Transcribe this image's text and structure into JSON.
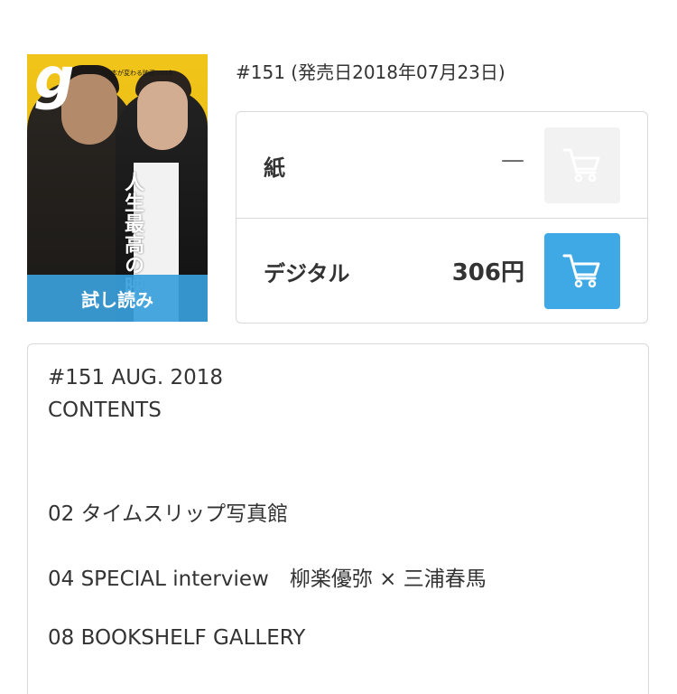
{
  "cover": {
    "alt": "magazine cover",
    "preview_label": "試し読み",
    "cover_title_vertical": "人生最高の映",
    "cover_tagline": "日本が変わる映画100本"
  },
  "issue": {
    "line": "#151 (発売日2018年07月23日)"
  },
  "prices": {
    "paper": {
      "label": "紙",
      "price": "—",
      "cart_state": "disabled"
    },
    "digital": {
      "label": "デジタル",
      "price": "306円",
      "cart_state": "active"
    }
  },
  "colors": {
    "accent": "#3fa9e6",
    "disabled_bg": "#f2f2f2",
    "border": "#d9d9d9",
    "text": "#333333"
  },
  "contents": {
    "heading_issue": "#151 AUG. 2018",
    "heading_label": "CONTENTS",
    "items": [
      "02 タイムスリップ写真館",
      "04 SPECIAL interview　柳楽優弥 × 三浦春馬",
      "08 BOOKSHELF GALLERY"
    ]
  },
  "icons": {
    "cart": "shopping-cart-icon"
  }
}
